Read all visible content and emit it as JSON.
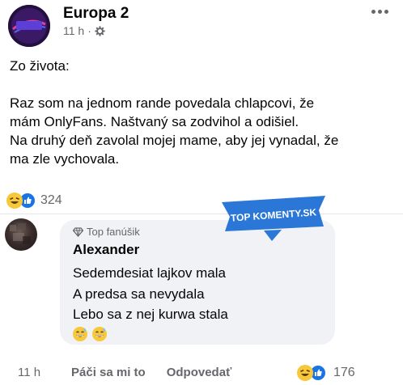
{
  "colors": {
    "text": "#050505",
    "secondary": "#65676b",
    "bubble": "#f0f2f5",
    "like_blue": "#1b74e4",
    "haha_yellow": "#f7c83a",
    "stamp_blue": "#2a77d8"
  },
  "post": {
    "page_name": "Europa 2",
    "avatar_logo_text": "EUROPA 2",
    "time": "11 h",
    "separator": "·",
    "audience_icon": "gear-icon",
    "more_icon": "more-options-icon",
    "intro": "Zo života:",
    "body_lines": [
      "Raz som na jednom rande povedala chlapcovi, že",
      "mám OnlyFans. Naštvaný sa zodvihol a odišiel.",
      "Na druhý deň zavolal mojej mame, aby jej vynadal, že",
      "ma zle vychovala."
    ],
    "reactions": {
      "icons": [
        "haha-icon",
        "like-icon"
      ],
      "count": "324"
    }
  },
  "watermark": {
    "text": "TOP KOMENTY.SK"
  },
  "comment": {
    "badge_icon": "diamond-icon",
    "badge": "Top fanúšik",
    "author": "Alexander",
    "lines": [
      "Sedemdesiat lajkov mala",
      "A predsa sa nevydala",
      "Lebo sa z nej kurwa stala"
    ],
    "emojis": [
      "grinning-sweat-icon",
      "grinning-sweat-icon"
    ],
    "time": "11 h",
    "like_label": "Páči sa mi to",
    "reply_label": "Odpovedať",
    "reactions": {
      "icons": [
        "haha-icon",
        "like-icon"
      ],
      "count": "176"
    }
  }
}
